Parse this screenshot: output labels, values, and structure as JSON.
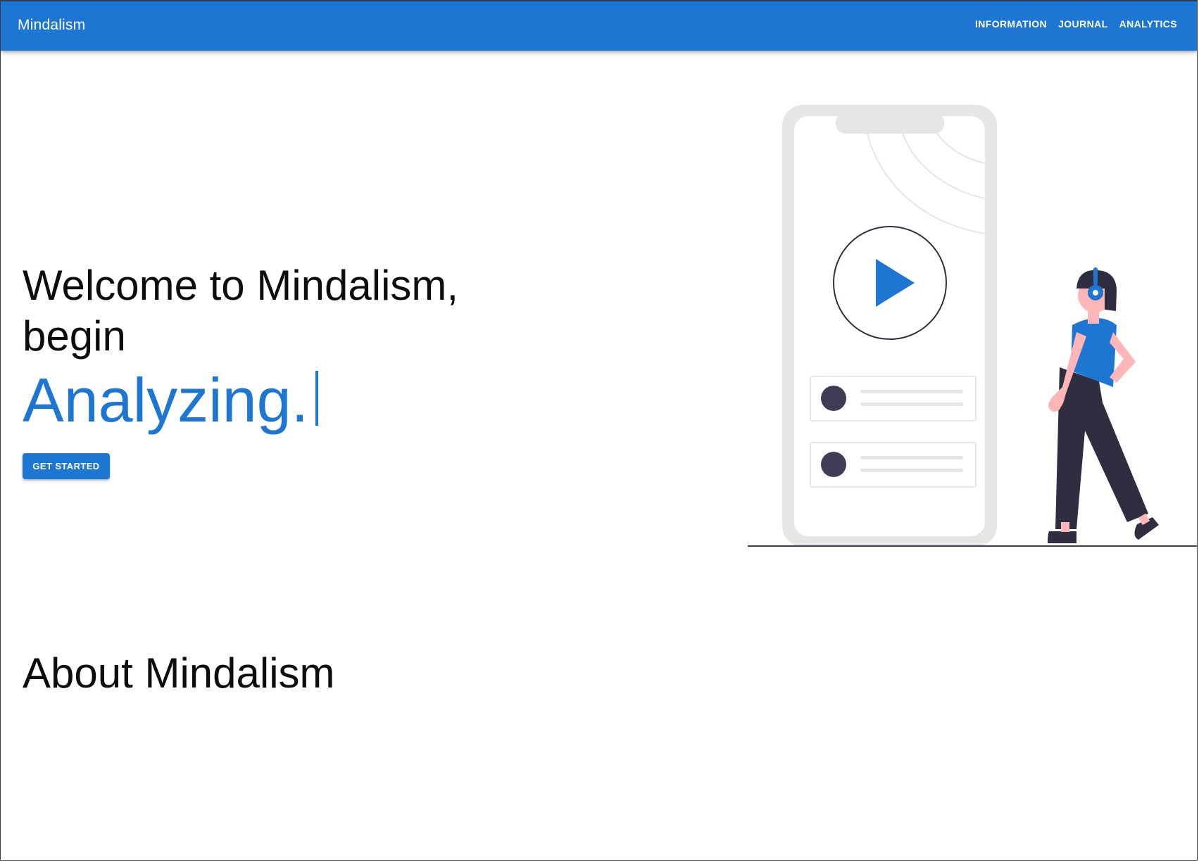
{
  "appbar": {
    "brand": "Mindalism",
    "nav": [
      "INFORMATION",
      "JOURNAL",
      "ANALYTICS"
    ]
  },
  "hero": {
    "title": "Welcome to Mindalism, begin",
    "typed_word": "Analyzing.",
    "cta_label": "GET STARTED"
  },
  "about": {
    "title": "About Mindalism"
  },
  "colors": {
    "primary": "#1c76d2",
    "dark": "#2f2e41",
    "phone_frame": "#e6e6e6",
    "skin": "#ffb6b6"
  },
  "icons": {
    "play": "play-icon",
    "headphones": "headphones-icon"
  }
}
